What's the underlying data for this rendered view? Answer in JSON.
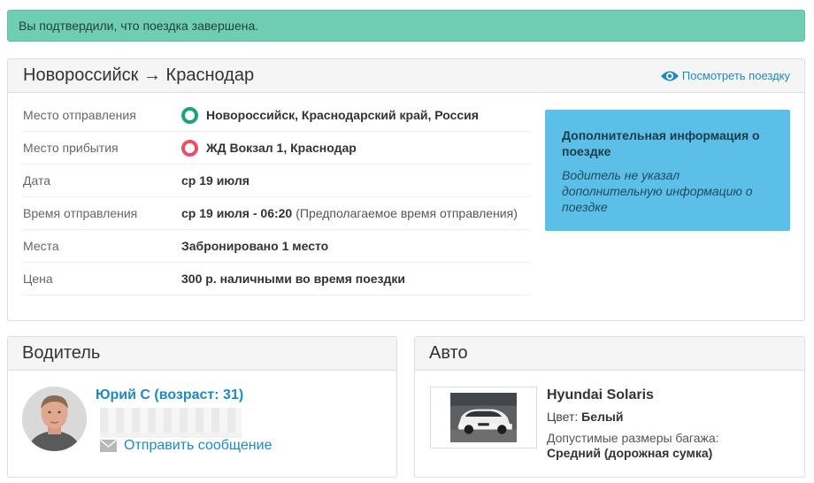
{
  "alert": {
    "text": "Вы подтвердили, что поездка завершена."
  },
  "trip": {
    "title": "Новороссийск → Краснодар",
    "view_link": "Посмотреть поездку",
    "rows": [
      {
        "label": "Место отправления",
        "value": "Новороссийск, Краснодарский край, Россия",
        "note": "",
        "pin": "green"
      },
      {
        "label": "Место прибытия",
        "value": "ЖД Вокзал 1, Краснодар",
        "note": "",
        "pin": "red"
      },
      {
        "label": "Дата",
        "value": "ср 19 июля",
        "note": ""
      },
      {
        "label": "Время отправления",
        "value": "ср 19 июля - 06:20",
        "note": "(Предполагаемое время отправления)"
      },
      {
        "label": "Места",
        "value": "Забронировано 1 место",
        "note": ""
      },
      {
        "label": "Цена",
        "value": "300 р. наличными во время поездки",
        "note": ""
      }
    ],
    "info": {
      "title": "Дополнительная информация о поездке",
      "text": "Водитель не указал дополнительную информацию о поездке"
    }
  },
  "driver": {
    "title": "Водитель",
    "name": "Юрий С (возраст: 31)",
    "message_link": "Отправить сообщение"
  },
  "auto": {
    "title": "Авто",
    "model": "Hyundai Solaris",
    "color_label": "Цвет:",
    "color_value": "Белый",
    "luggage_label": "Допустимые размеры багажа:",
    "luggage_value": "Средний (дорожная сумка)"
  },
  "colors": {
    "accent": "#1b8bc4",
    "alert_bg": "#6ecdb2",
    "info_bg": "#5bbfe7",
    "pin_green": "#17a673",
    "pin_red": "#ea5063"
  }
}
